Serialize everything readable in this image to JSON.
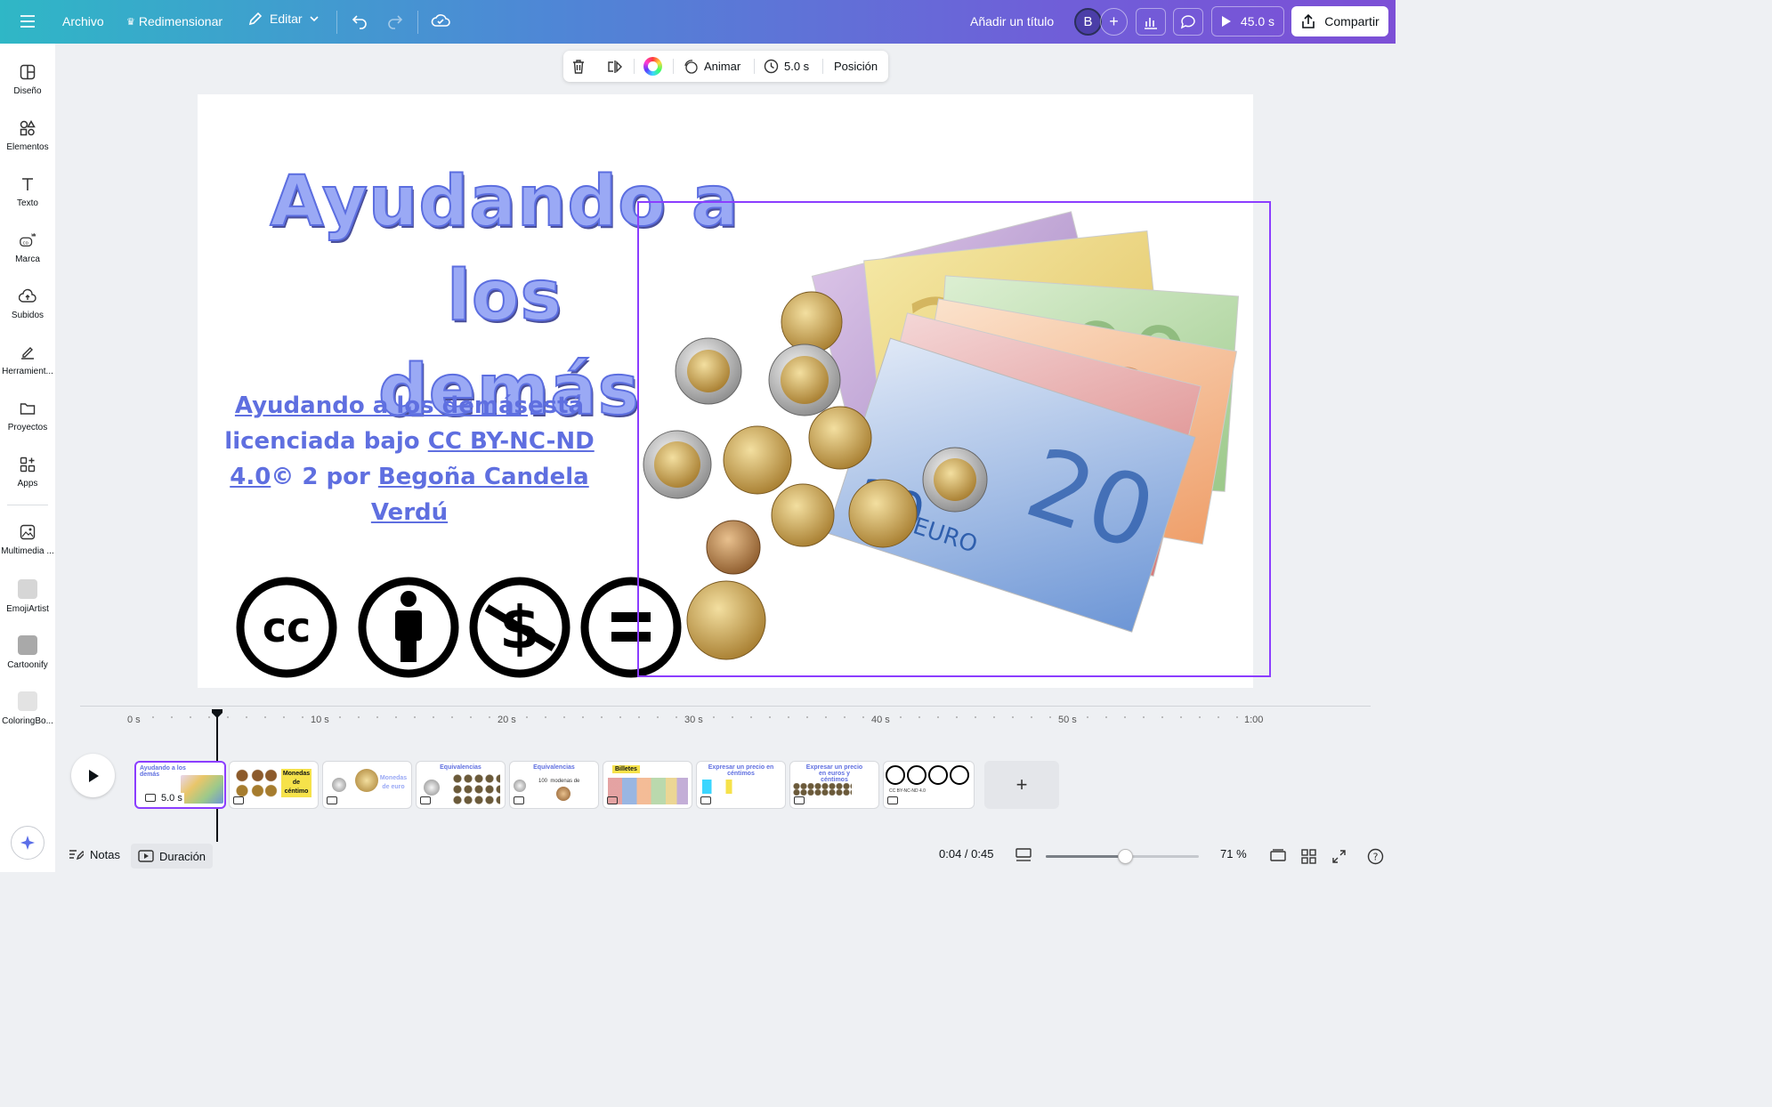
{
  "topbar": {
    "archivo": "Archivo",
    "resize": "Redimensionar",
    "edit": "Editar",
    "add_title": "Añadir un título",
    "avatar_initial": "B",
    "play_duration": "45.0 s",
    "share": "Compartir"
  },
  "sidebar": {
    "items": [
      {
        "label": "Diseño",
        "icon": "layout-icon"
      },
      {
        "label": "Elementos",
        "icon": "shapes-icon"
      },
      {
        "label": "Texto",
        "icon": "text-icon"
      },
      {
        "label": "Marca",
        "icon": "brand-icon"
      },
      {
        "label": "Subidos",
        "icon": "upload-cloud-icon"
      },
      {
        "label": "Herramient...",
        "icon": "draw-tools-icon"
      },
      {
        "label": "Proyectos",
        "icon": "folder-icon"
      },
      {
        "label": "Apps",
        "icon": "apps-icon"
      },
      {
        "label": "Multimedia ...",
        "icon": "media-icon"
      },
      {
        "label": "EmojiArtist",
        "icon": "emojiartist-app-icon"
      },
      {
        "label": "Cartoonify",
        "icon": "cartoonify-app-icon"
      },
      {
        "label": "ColoringBo...",
        "icon": "coloringbook-app-icon"
      }
    ]
  },
  "floating_toolbar": {
    "animate": "Animar",
    "duration": "5.0 s",
    "position": "Posición"
  },
  "canvas": {
    "title_line1": "Ayudando a los",
    "title_line2": "demás",
    "license": {
      "part1": "Ayudando a los demás",
      "part2": "está licenciada bajo ",
      "link1": "CC BY-NC-ND 4.0",
      "part3": "© 2 por ",
      "link2": "Begoña Candela Verdú"
    },
    "cc_icons": [
      "cc-icon",
      "by-attribution-icon",
      "nc-noncommercial-icon",
      "nd-noderivatives-icon"
    ],
    "image_alt": "euro banknotes and coins"
  },
  "timeline": {
    "ruler_labels": [
      "0 s",
      "10 s",
      "20 s",
      "30 s",
      "40 s",
      "50 s",
      "1:00"
    ],
    "clips": [
      {
        "caption": "Ayudando a los demás",
        "duration": "5.0 s"
      },
      {
        "caption": "Monedas de céntimo"
      },
      {
        "caption": "Monedas de euro"
      },
      {
        "caption": "Equivalencias"
      },
      {
        "caption": "Equivalencias"
      },
      {
        "caption": "Billetes"
      },
      {
        "caption": "Expresar un precio en céntimos"
      },
      {
        "caption": "Expresar un precio en euros y céntimos"
      },
      {
        "caption": "CC BY-NC-ND 4.0"
      }
    ]
  },
  "bottom": {
    "notes": "Notas",
    "duration": "Duración",
    "time": "0:04 / 0:45",
    "zoom": "71 %",
    "zoom_fraction": 0.52
  },
  "colors": {
    "accent": "#8b3dff",
    "title_fill": "#9aa9f5",
    "link_blue": "#5f6fe0"
  }
}
